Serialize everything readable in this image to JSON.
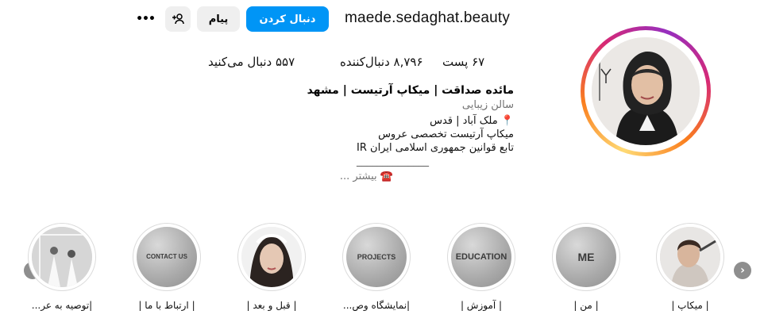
{
  "header": {
    "username": "maede.sedaghat.beauty",
    "follow_label": "دنبال کردن",
    "message_label": "پیام",
    "adduser_icon": "+☺",
    "more_label": "•••"
  },
  "stats": {
    "posts": "۶۷ پست",
    "followers": "۸,۷۹۶ دنبال‌کننده",
    "following": "۵۵۷ دنبال می‌کنید"
  },
  "bio": {
    "name": "مائده صداقت | میکاپ آرتیست | مشهد",
    "category": "سالن زیبایی",
    "lines": [
      "📍 ملک آباد | قدس",
      "میکاپ آرتیست تخصصی عروس",
      "تابع قوانین جمهوری اسلامی ایران IR",
      "______________"
    ],
    "more": "☎️ بیشتر ..."
  },
  "highlights": [
    {
      "label": "| میکاپ |",
      "cover_text": ""
    },
    {
      "label": "| من |",
      "cover_text": "ME"
    },
    {
      "label": "| آموزش |",
      "cover_text": "EDUCATION"
    },
    {
      "label": "|نمایشگاه وص...",
      "cover_text": "PROJECTS"
    },
    {
      "label": "| قبل و بعد |",
      "cover_text": ""
    },
    {
      "label": "| ارتباط با ما |",
      "cover_text": "CONTACT US"
    },
    {
      "label": "|توصیه به عر...",
      "cover_text": ""
    }
  ],
  "nav": {
    "prev": "‹",
    "next": "›"
  },
  "colors": {
    "follow_button": "#0095f6",
    "secondary_button": "#efefef",
    "muted_text": "#737373"
  }
}
